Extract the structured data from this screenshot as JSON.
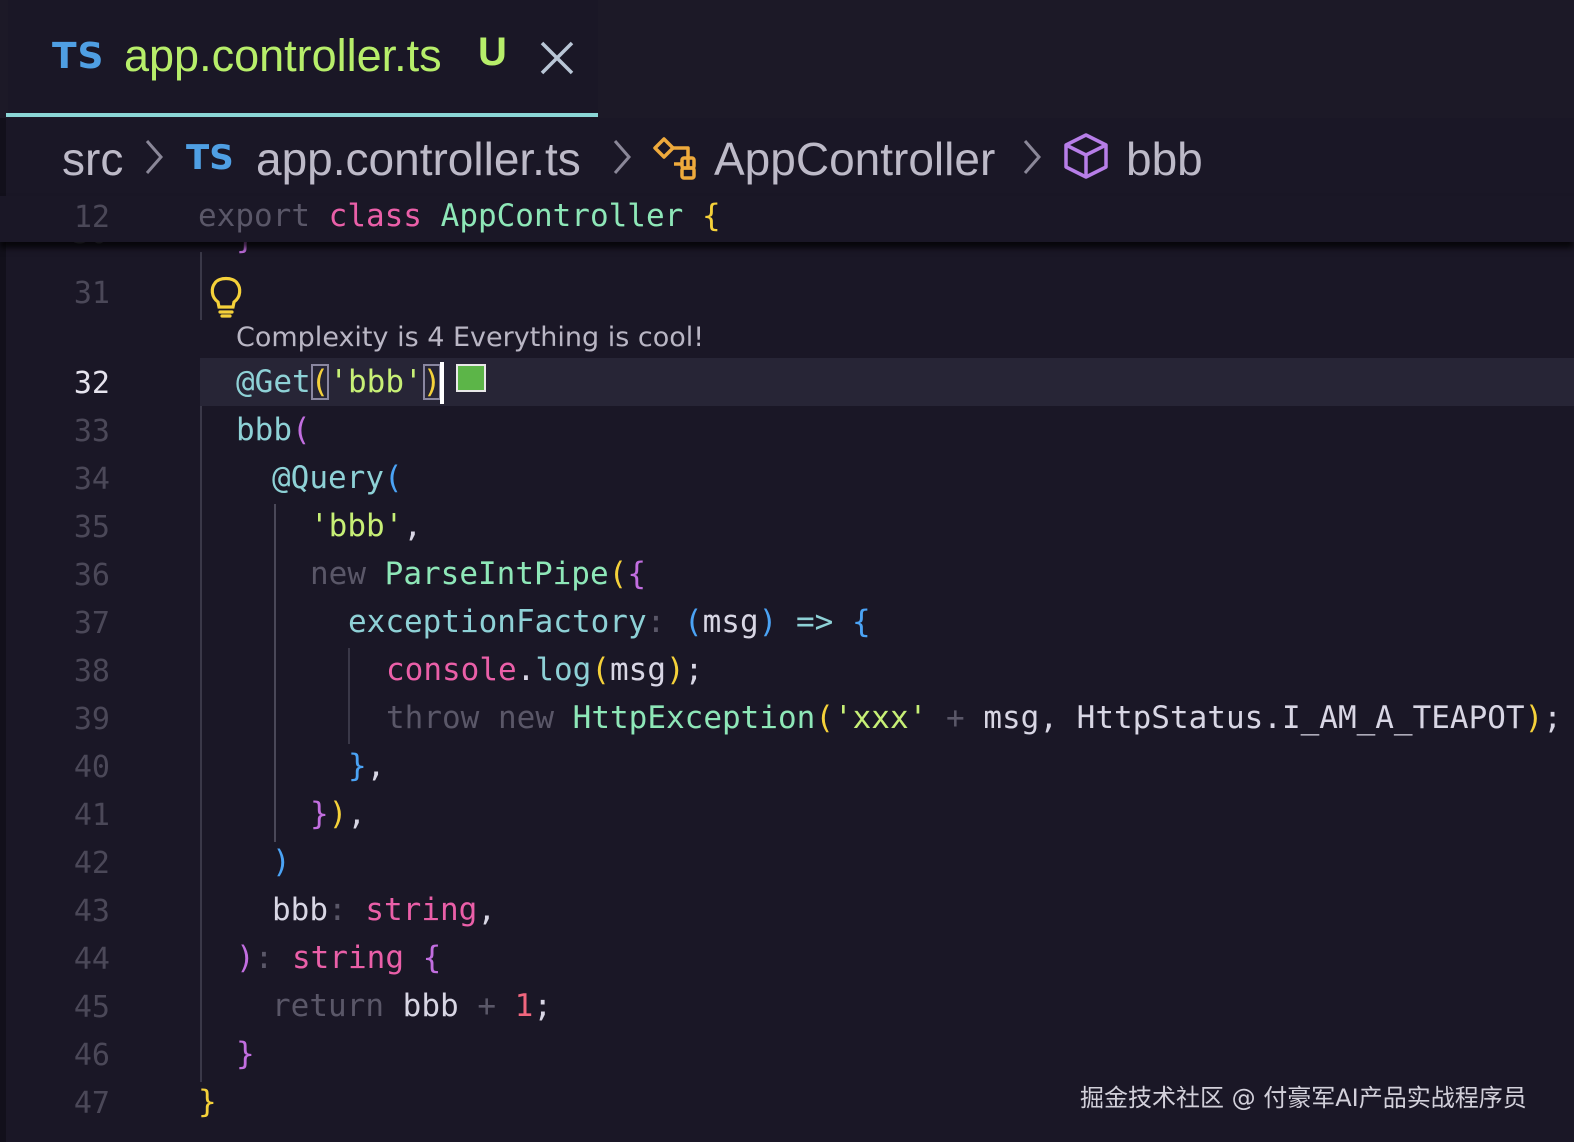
{
  "tab": {
    "lang_badge": "TS",
    "filename": "app.controller.ts",
    "status": "U",
    "close_icon": "close-icon"
  },
  "breadcrumb": {
    "folder": "src",
    "file_badge": "TS",
    "file": "app.controller.ts",
    "class_icon": "class-icon",
    "class": "AppController",
    "method_icon": "method-icon",
    "method": "bbb"
  },
  "sticky": {
    "line": "12",
    "t1": "export",
    "t2": "class",
    "t3": "AppController",
    "t4": "{"
  },
  "editor": {
    "lens": "Complexity is 4 Everything is cool!",
    "lines": {
      "l31": "31",
      "l32": "32",
      "l33": "33",
      "l34": "34",
      "l35": "35",
      "l36": "36",
      "l37": "37",
      "l38": "38",
      "l39": "39",
      "l40": "40",
      "l41": "41",
      "l42": "42",
      "l43": "43",
      "l44": "44",
      "l45": "45",
      "l46": "46",
      "l47": "47"
    },
    "tokens": {
      "get_at": "@Get",
      "get_lp": "(",
      "get_str": "'bbb'",
      "get_rp": ")",
      "bbb_name": "bbb",
      "bbb_lp": "(",
      "query": "@Query",
      "query_lp": "(",
      "str_bbb": "'bbb'",
      "comma1": ",",
      "new1": "new",
      "pipe": "ParseIntPipe",
      "pipe_lp": "(",
      "pipe_lb": "{",
      "ef": "exceptionFactory",
      "ef_colon": ":",
      "ef_lp": "(",
      "ef_msg": "msg",
      "ef_rp": ")",
      "arrow": "=>",
      "ef_lb": "{",
      "console": "console",
      "dot1": ".",
      "log": "log",
      "log_lp": "(",
      "log_msg": "msg",
      "log_rp": ")",
      "semi1": ";",
      "throw": "throw",
      "new2": "new",
      "httpex": "HttpException",
      "hx_lp": "(",
      "xxx": "'xxx'",
      "plus1": "+",
      "hx_msg": "msg,",
      "status": "HttpStatus.I_AM_A_TEAPOT",
      "hx_rp": ")",
      "semi2": ";",
      "l40_rb": "}",
      "l40_c": ",",
      "l41_rb": "}",
      "l41_rp": ")",
      "l41_c": ",",
      "l42_rp": ")",
      "p_bbb": "bbb",
      "p_colon": ":",
      "p_type": "string",
      "p_comma": ",",
      "r_rp": ")",
      "r_colon": ":",
      "r_type": "string",
      "r_lb": "{",
      "ret": "return",
      "ret_bbb": "bbb",
      "plus2": "+",
      "one": "1",
      "semi3": ";",
      "l46_rb": "}",
      "l47_rb": "}"
    }
  },
  "watermark": "掘金技术社区 @ 付豪军AI产品实战程序员",
  "colors": {
    "background": "#1a1726",
    "accent": "#8bd6d6",
    "swatch": "#5cb548"
  }
}
